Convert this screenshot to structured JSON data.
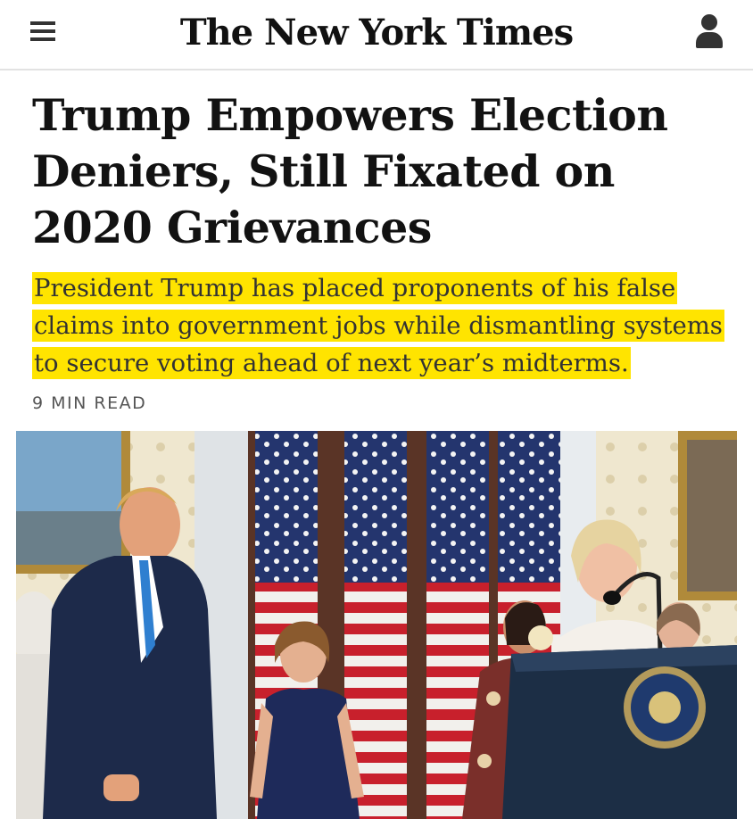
{
  "header": {
    "masthead": "The New York Times",
    "menu_icon": "hamburger-menu-icon",
    "account_icon": "user-account-icon"
  },
  "article": {
    "headline": "Trump Empowers Election Deniers, Still Fixated on 2020 Grievances",
    "summary": "President Trump has placed proponents of his false claims into government jobs while dismantling systems to secure voting ahead of next year’s midterms.",
    "read_time": "9 MIN READ",
    "highlight_color": "#ffe400"
  },
  "photo": {
    "description_icon": "article-lead-photo"
  }
}
